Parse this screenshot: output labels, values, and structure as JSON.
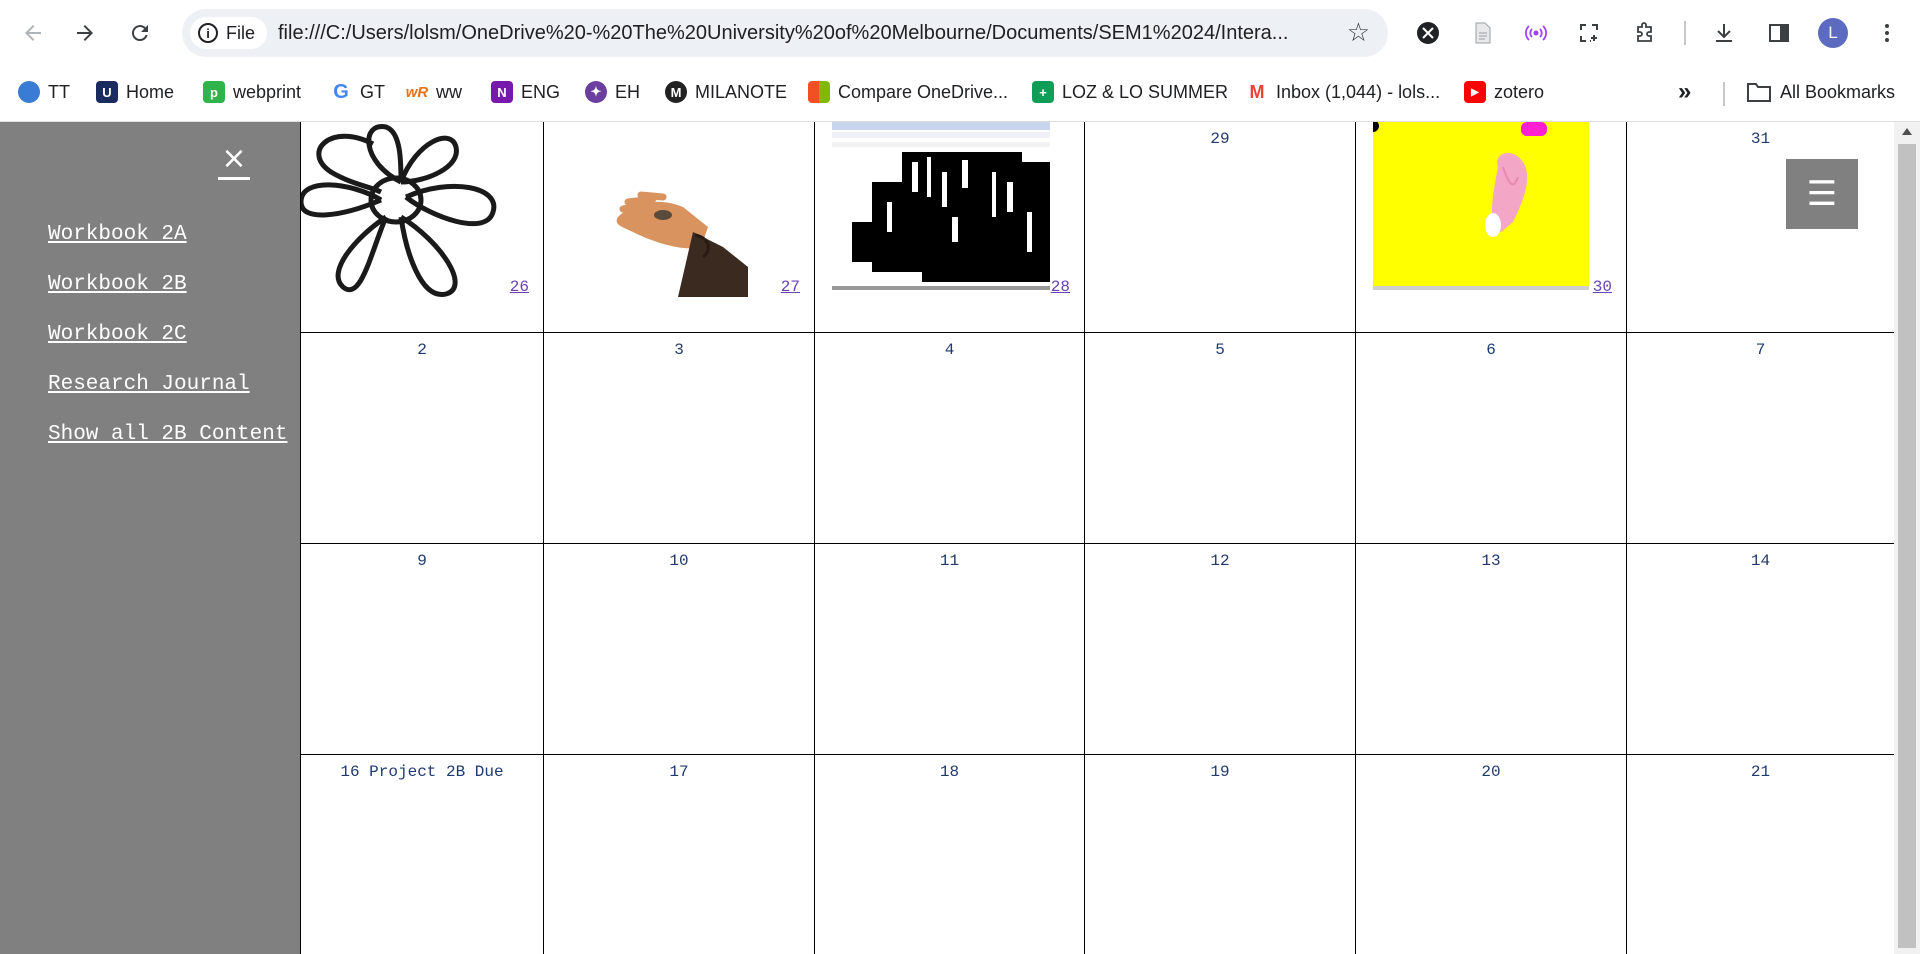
{
  "browser": {
    "site_chip_label": "File",
    "url": "file:///C:/Users/lolsm/OneDrive%20-%20The%20University%20of%20Melbourne/Documents/SEM1%2024/Intera...",
    "profile_initial": "L",
    "bookmarks": [
      {
        "label": "TT",
        "icon": "tt-icon",
        "color": "#3a7bd5"
      },
      {
        "label": "Home",
        "icon": "home-icon",
        "color": "#1a2b5f"
      },
      {
        "label": "webprint",
        "icon": "webprint-icon",
        "color": "#2fb34a"
      },
      {
        "label": "GT",
        "icon": "google-icon",
        "color": "#4285f4"
      },
      {
        "label": "ww",
        "icon": "ww-icon",
        "color": "#e8711a"
      },
      {
        "label": "ENG",
        "icon": "onenote-icon",
        "color": "#7719aa"
      },
      {
        "label": "EH",
        "icon": "eh-icon",
        "color": "#6b3fa0"
      },
      {
        "label": "MILANOTE",
        "icon": "milanote-icon",
        "color": "#222222"
      },
      {
        "label": "Compare OneDrive...",
        "icon": "microsoft-icon",
        "color": "#f25022"
      },
      {
        "label": "LOZ & LO SUMMER",
        "icon": "sheets-icon",
        "color": "#0f9d58"
      },
      {
        "label": "Inbox (1,044) - lols...",
        "icon": "gmail-icon",
        "color": "#ea4335"
      },
      {
        "label": "zotero",
        "icon": "youtube-icon",
        "color": "#ff0000"
      }
    ],
    "all_bookmarks_label": "All Bookmarks",
    "more_label": "»"
  },
  "sidebar": {
    "close_label": "×",
    "items": [
      {
        "label": "Workbook 2A"
      },
      {
        "label": "Workbook 2B"
      },
      {
        "label": "Workbook 2C"
      },
      {
        "label": "Research Journal"
      },
      {
        "label": "Show all 2B Content"
      }
    ]
  },
  "menu_label": "☰",
  "calendar": {
    "week1": [
      {
        "day": "26",
        "link": true,
        "image": "flower-drawing"
      },
      {
        "day": "27",
        "link": true,
        "image": "hand-holding-coin"
      },
      {
        "day": "28",
        "link": true,
        "image": "screenshot-collage"
      },
      {
        "day": "29",
        "link": false
      },
      {
        "day": "30",
        "link": true,
        "image": "yellow-pink-figure"
      },
      {
        "day": "31",
        "link": false
      }
    ],
    "week2": [
      "2",
      "3",
      "4",
      "5",
      "6",
      "7"
    ],
    "week3": [
      "9",
      "10",
      "11",
      "12",
      "13",
      "14"
    ],
    "week4": [
      "16 Project 2B Due",
      "17",
      "18",
      "19",
      "20",
      "21"
    ]
  },
  "colors": {
    "sidebar": "#808080",
    "day_number": "#1f3a6e",
    "day_link": "#6a3fb5",
    "yellow_image": "#ffff00"
  }
}
